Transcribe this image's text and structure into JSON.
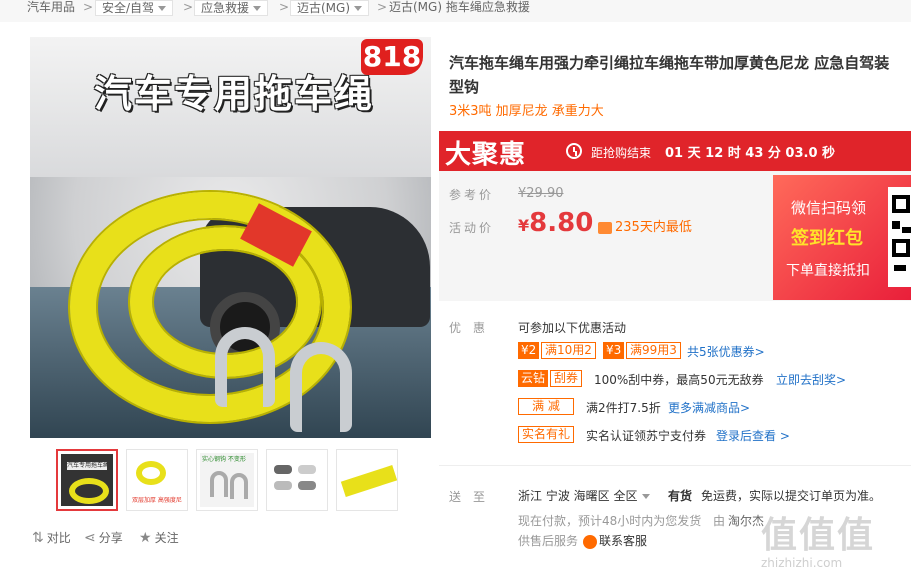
{
  "breadcrumb": [
    {
      "label": "汽车用品",
      "dropdown": false
    },
    {
      "label": "安全/自驾",
      "dropdown": true
    },
    {
      "label": "应急救援",
      "dropdown": true
    },
    {
      "label": "迈古(MG)",
      "dropdown": true
    },
    {
      "label": "迈古(MG) 拖车绳应急救援",
      "dropdown": false
    }
  ],
  "breadcrumb_sep": ">",
  "main_image": {
    "banner_text": "汽车专用拖车绳",
    "badge": "818"
  },
  "thumbnails": [
    {
      "name": "thumb-1",
      "caption": "汽车专用拖车绳"
    },
    {
      "name": "thumb-2",
      "caption": "双层加厚 高强度尼龙材料"
    },
    {
      "name": "thumb-3",
      "caption": "实心钢钩 不变形"
    },
    {
      "name": "thumb-4",
      "caption": ""
    },
    {
      "name": "thumb-5",
      "caption": ""
    }
  ],
  "actions": {
    "compare": "对比",
    "share": "分享",
    "follow": "关注"
  },
  "product": {
    "title_line1": "汽车拖车绳车用强力牵引绳拉车绳拖车带加厚黄色尼龙 应急自驾装",
    "title_line2": "型钩",
    "subtitle": "3米3吨 加厚尼龙 承重力大"
  },
  "promo": {
    "logo": "大聚惠",
    "countdown_label": "距抢购结束",
    "countdown": "01 天 12 时 43 分 03.0 秒"
  },
  "price": {
    "ref_label": "参考价",
    "ref_value": "¥29.90",
    "act_label": "活动价",
    "currency": "¥",
    "act_value": "8.80",
    "low_tag": "235天内最低"
  },
  "qr_promo": {
    "line1": "微信扫码领",
    "line2": "签到红包",
    "line3": "下单直接抵扣"
  },
  "discounts": {
    "label": "优惠",
    "intro": "可参加以下优惠活动",
    "coupon1_amount": "¥2",
    "coupon1_cond": "满10用2",
    "coupon2_amount": "¥3",
    "coupon2_cond": "满99用3",
    "coupons_link": "共5张优惠券>",
    "scratch_tag1": "云钻",
    "scratch_tag2": "刮券",
    "scratch_text": "100%刮中券，最高50元无敌券",
    "scratch_link": "立即去刮奖>",
    "fullcut_tag": "满 减",
    "fullcut_text": "满2件打7.5折",
    "fullcut_link": "更多满减商品>",
    "realname_tag": "实名有礼",
    "realname_text": "实名认证领苏宁支付券",
    "realname_link": "登录后查看 >"
  },
  "delivery": {
    "label": "送至",
    "address": "浙江 宁波 海曙区 全区",
    "stock": "有货",
    "shipping": "免运费，实际以提交订单页为准。",
    "eta": "现在付款，预计48小时内为您发货",
    "seller_prefix": "由",
    "seller": "淘尔杰",
    "service_label": "供售后服务",
    "contact": "联系客服"
  },
  "watermark": {
    "logo": "值值值",
    "url": "zhizhizhi.com"
  },
  "colors": {
    "brand_red": "#e0242a",
    "price_red": "#e4393c",
    "accent_orange": "#ff6a00",
    "link_blue": "#2272c8"
  }
}
